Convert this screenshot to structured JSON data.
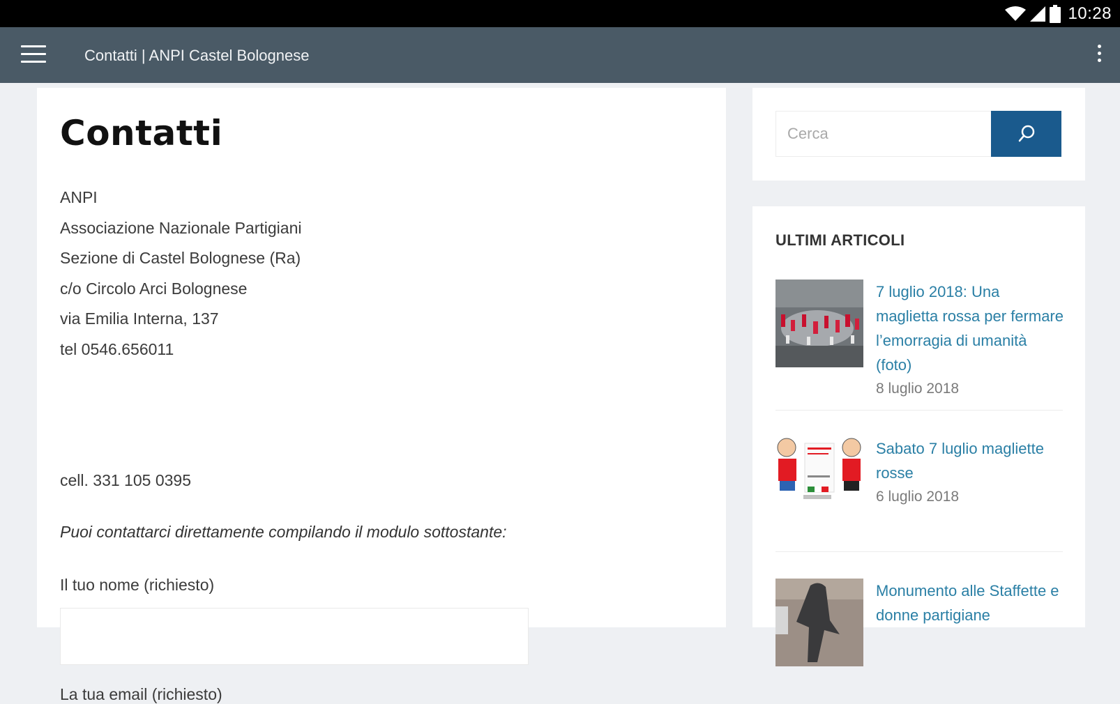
{
  "status_bar": {
    "time": "10:28"
  },
  "app_bar": {
    "title": "Contatti | ANPI Castel Bolognese"
  },
  "page": {
    "title": "Contatti",
    "address_lines": [
      "ANPI",
      "Associazione Nazionale Partigiani",
      "Sezione di Castel Bolognese (Ra)",
      "c/o Circolo Arci Bolognese",
      "via Emilia Interna, 137",
      "tel 0546.656011"
    ],
    "cell": "cell. 331 105 0395",
    "intro": "Puoi contattarci direttamente compilando il modulo sottostante:",
    "form": {
      "name_label": "Il tuo nome (richiesto)",
      "name_value": "",
      "email_label": "La tua email (richiesto)"
    }
  },
  "sidebar": {
    "search": {
      "placeholder": "Cerca"
    },
    "recent_heading": "ULTIMI ARTICOLI",
    "articles": [
      {
        "title": "7 luglio 2018: Una maglietta rossa per fermare l’emorragia di umanità (foto)",
        "date": "8 luglio 2018"
      },
      {
        "title": "Sabato 7 luglio magliette rosse",
        "date": "6 luglio 2018"
      },
      {
        "title": "Monumento alle Staffette e donne partigiane",
        "date": ""
      }
    ]
  },
  "colors": {
    "status_bar": "#000000",
    "app_bar": "#4a5a66",
    "search_button": "#1a5a8d",
    "link": "#2a7fa5",
    "background": "#eef0f3"
  },
  "icons": {
    "menu": "hamburger-icon",
    "more": "more-vert-icon",
    "search": "search-icon",
    "wifi": "wifi-icon",
    "signal": "signal-icon",
    "battery": "battery-icon"
  }
}
